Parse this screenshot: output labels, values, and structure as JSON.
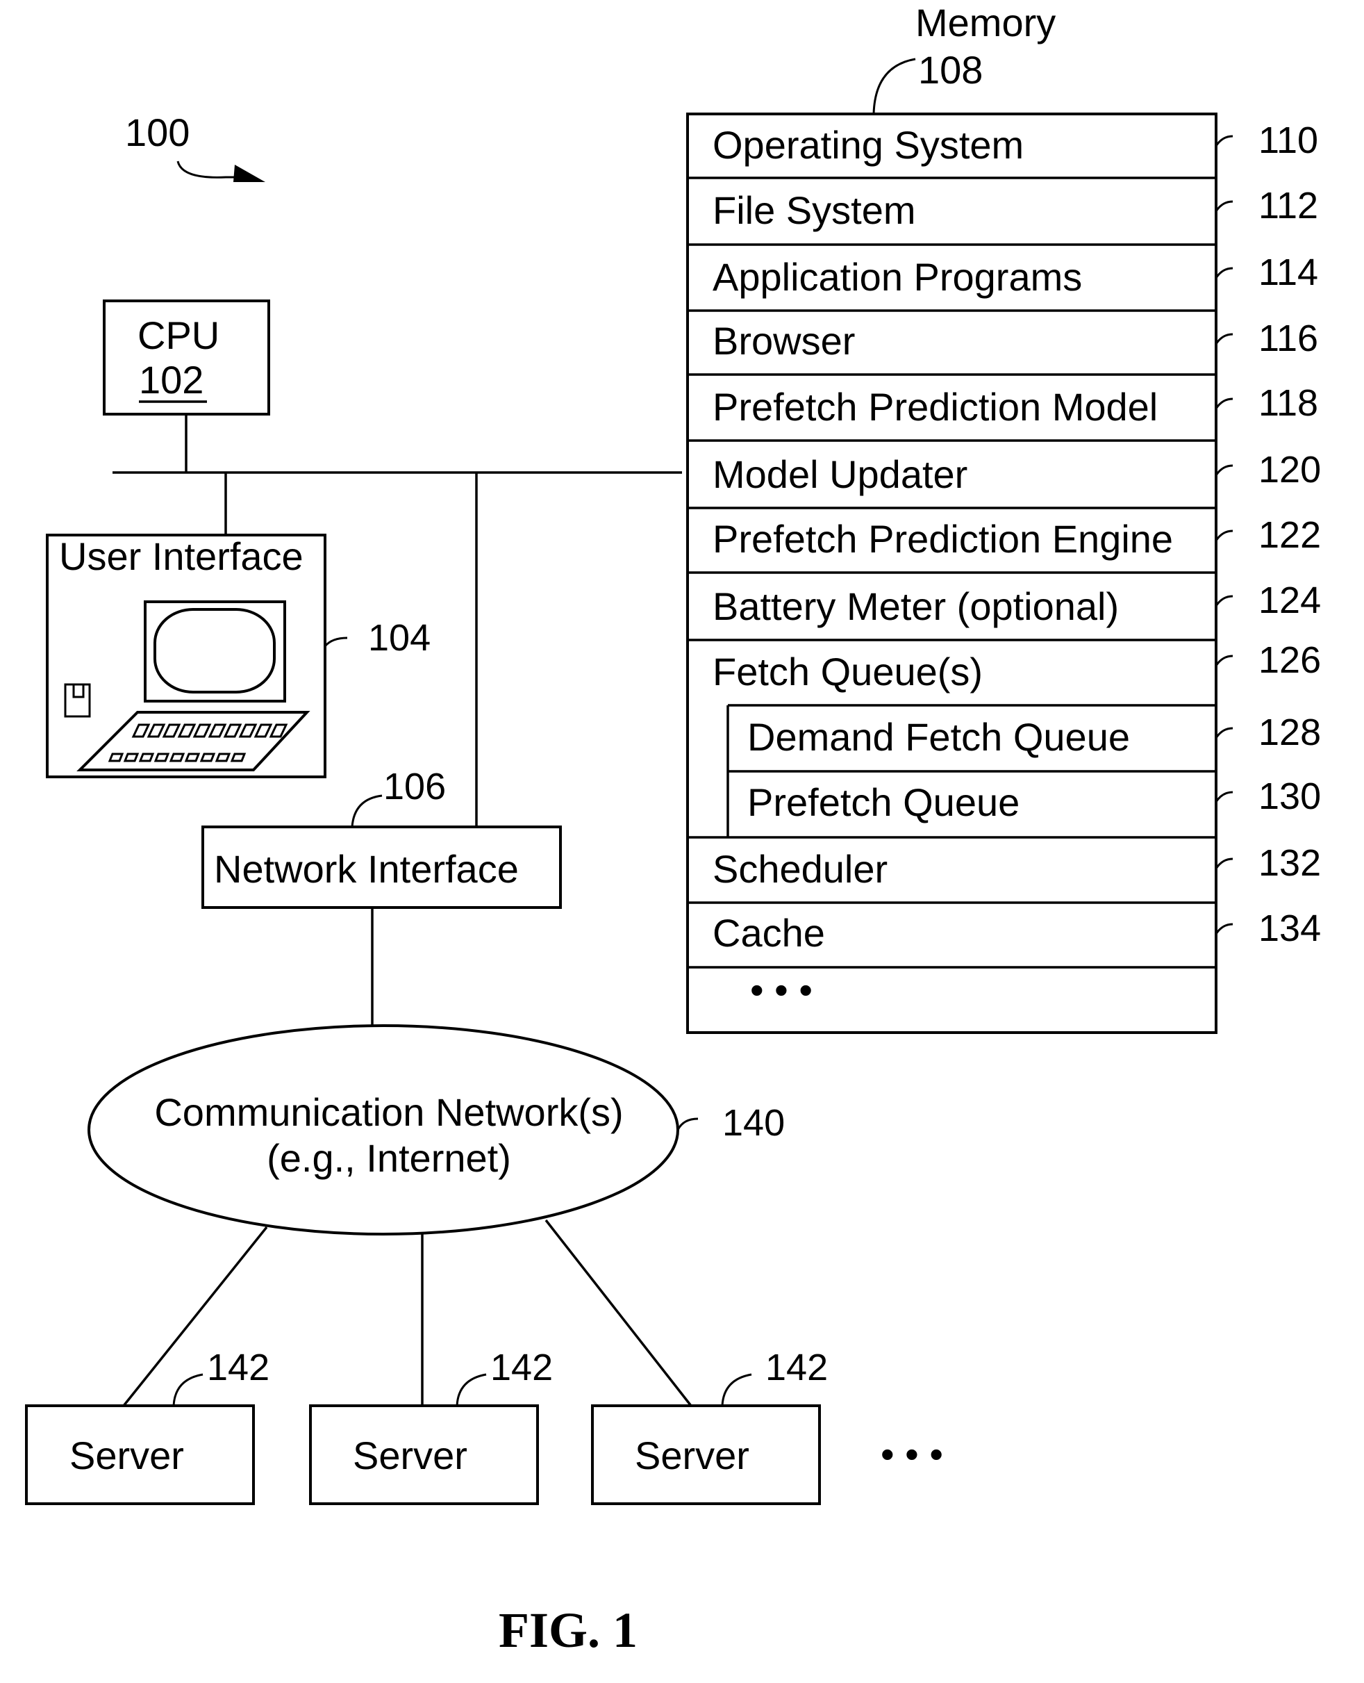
{
  "figure": {
    "system_ref": "100",
    "caption": "FIG. 1"
  },
  "cpu": {
    "label": "CPU",
    "ref": "102"
  },
  "user_interface": {
    "label": "User Interface",
    "ref": "104"
  },
  "network_interface": {
    "label": "Network Interface",
    "ref": "106"
  },
  "memory": {
    "label": "Memory",
    "ref": "108",
    "items": [
      {
        "label": "Operating System",
        "ref": "110"
      },
      {
        "label": "File System",
        "ref": "112"
      },
      {
        "label": "Application Programs",
        "ref": "114"
      },
      {
        "label": "Browser",
        "ref": "116"
      },
      {
        "label": "Prefetch Prediction Model",
        "ref": "118"
      },
      {
        "label": "Model Updater",
        "ref": "120"
      },
      {
        "label": "Prefetch Prediction Engine",
        "ref": "122"
      },
      {
        "label": "Battery Meter (optional)",
        "ref": "124"
      },
      {
        "label": "Fetch Queue(s)",
        "ref": "126"
      },
      {
        "label": "Demand Fetch Queue",
        "ref": "128"
      },
      {
        "label": "Prefetch Queue",
        "ref": "130"
      },
      {
        "label": "Scheduler",
        "ref": "132"
      },
      {
        "label": "Cache",
        "ref": "134"
      }
    ],
    "ellipsis": "• • •"
  },
  "network": {
    "line1": "Communication Network(s)",
    "line2": "(e.g., Internet)",
    "ref": "140"
  },
  "servers": [
    {
      "label": "Server",
      "ref": "142"
    },
    {
      "label": "Server",
      "ref": "142"
    },
    {
      "label": "Server",
      "ref": "142"
    }
  ],
  "servers_ellipsis": "• • •"
}
